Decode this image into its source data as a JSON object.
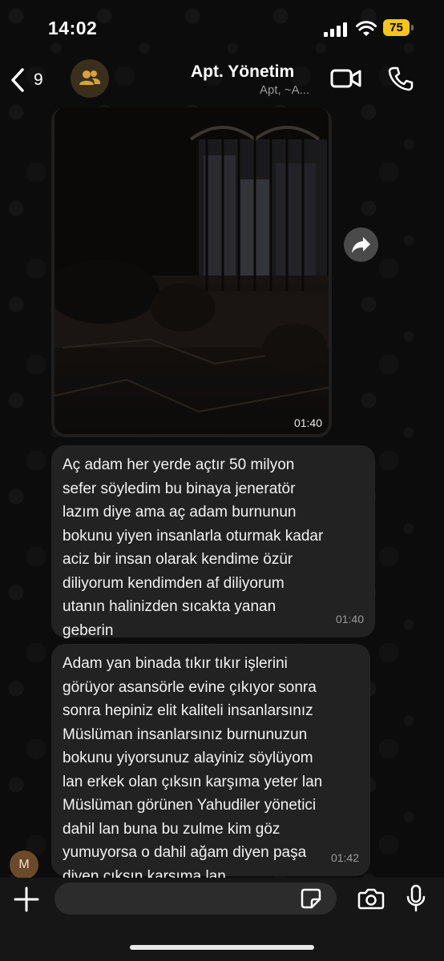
{
  "status_bar": {
    "time": "14:02",
    "battery": "75"
  },
  "header": {
    "back_count": "9",
    "title": "Apt. Yönetim",
    "subtitle": "Apt, ~A..."
  },
  "messages": [
    {
      "type": "video",
      "time": "01:40"
    },
    {
      "type": "text",
      "time": "01:40",
      "text": "Aç adam her yerde açtır 50 milyon\nsefer söyledim bu binaya jeneratör\nlazım diye ama aç adam burnunun\nbokunu yiyen insanlarla oturmak kadar\naciz bir insan olarak kendime özür\ndiliyorum kendimden af diliyorum\nutanın halinizden sıcakta yanan\ngeberin"
    },
    {
      "type": "text",
      "time": "01:42",
      "text": "Adam yan binada tıkır tıkır işlerini\ngörüyor asansörle evine çıkıyor sonra\nsonra hepiniz elit kaliteli insanlarsınız\nMüslüman insanlarsınız burnunuzun\nbokunu yiyorsunuz alayiniz söylüyom\nlan erkek olan çıksın karşıma yeter lan\nMüslüman görünen Yahudiler yönetici\ndahil lan buna bu zulme kim göz\nyumuyorsa o dahil ağam diyen paşa\ndiyen çıksın karşıma lan"
    }
  ],
  "sender_avatar": {
    "initial": "M"
  },
  "composer": {
    "placeholder": ""
  },
  "icons": {
    "back": "chevron-left-icon",
    "group": "group-icon",
    "video": "video-camera-icon",
    "call": "phone-icon",
    "forward": "forward-icon",
    "plus": "plus-icon",
    "sticker": "sticker-icon",
    "camera": "camera-icon",
    "mic": "microphone-icon"
  },
  "colors": {
    "battery": "#f5c518",
    "group_avatar_bg": "#3a2f1d",
    "group_icon": "#d9a13b"
  }
}
